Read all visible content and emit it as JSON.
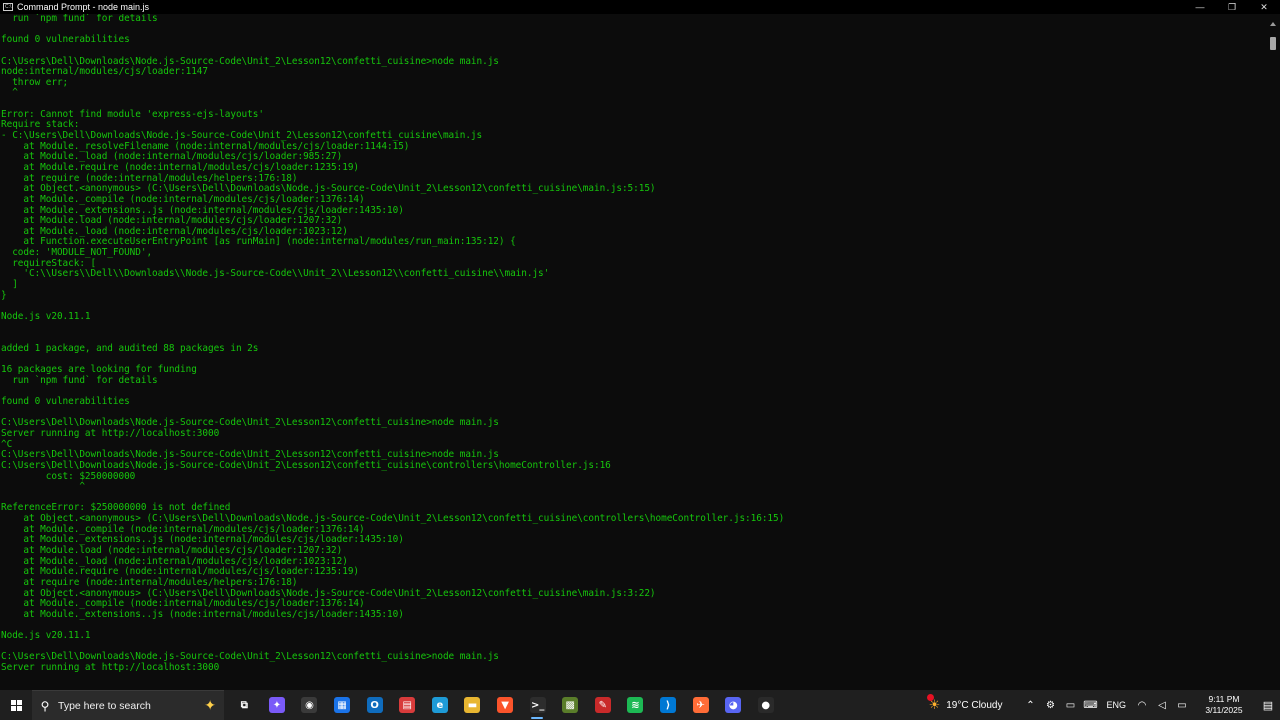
{
  "window": {
    "title": "Command Prompt - node  main.js",
    "icon_label": "C:\\"
  },
  "window_controls": {
    "minimize": "—",
    "maximize": "❐",
    "close": "✕"
  },
  "console_lines": [
    "  run `npm fund` for details",
    "",
    "found 0 vulnerabilities",
    "",
    "C:\\Users\\Dell\\Downloads\\Node.js-Source-Code\\Unit_2\\Lesson12\\confetti_cuisine>node main.js",
    "node:internal/modules/cjs/loader:1147",
    "  throw err;",
    "  ^",
    "",
    "Error: Cannot find module 'express-ejs-layouts'",
    "Require stack:",
    "- C:\\Users\\Dell\\Downloads\\Node.js-Source-Code\\Unit_2\\Lesson12\\confetti_cuisine\\main.js",
    "    at Module._resolveFilename (node:internal/modules/cjs/loader:1144:15)",
    "    at Module._load (node:internal/modules/cjs/loader:985:27)",
    "    at Module.require (node:internal/modules/cjs/loader:1235:19)",
    "    at require (node:internal/modules/helpers:176:18)",
    "    at Object.<anonymous> (C:\\Users\\Dell\\Downloads\\Node.js-Source-Code\\Unit_2\\Lesson12\\confetti_cuisine\\main.js:5:15)",
    "    at Module._compile (node:internal/modules/cjs/loader:1376:14)",
    "    at Module._extensions..js (node:internal/modules/cjs/loader:1435:10)",
    "    at Module.load (node:internal/modules/cjs/loader:1207:32)",
    "    at Module._load (node:internal/modules/cjs/loader:1023:12)",
    "    at Function.executeUserEntryPoint [as runMain] (node:internal/modules/run_main:135:12) {",
    "  code: 'MODULE_NOT_FOUND',",
    "  requireStack: [",
    "    'C:\\\\Users\\\\Dell\\\\Downloads\\\\Node.js-Source-Code\\\\Unit_2\\\\Lesson12\\\\confetti_cuisine\\\\main.js'",
    "  ]",
    "}",
    "",
    "Node.js v20.11.1",
    "",
    "",
    "added 1 package, and audited 88 packages in 2s",
    "",
    "16 packages are looking for funding",
    "  run `npm fund` for details",
    "",
    "found 0 vulnerabilities",
    "",
    "C:\\Users\\Dell\\Downloads\\Node.js-Source-Code\\Unit_2\\Lesson12\\confetti_cuisine>node main.js",
    "Server running at http://localhost:3000",
    "^C",
    "C:\\Users\\Dell\\Downloads\\Node.js-Source-Code\\Unit_2\\Lesson12\\confetti_cuisine>node main.js",
    "C:\\Users\\Dell\\Downloads\\Node.js-Source-Code\\Unit_2\\Lesson12\\confetti_cuisine\\controllers\\homeController.js:16",
    "        cost: $250000000",
    "              ^",
    "",
    "ReferenceError: $250000000 is not defined",
    "    at Object.<anonymous> (C:\\Users\\Dell\\Downloads\\Node.js-Source-Code\\Unit_2\\Lesson12\\confetti_cuisine\\controllers\\homeController.js:16:15)",
    "    at Module._compile (node:internal/modules/cjs/loader:1376:14)",
    "    at Module._extensions..js (node:internal/modules/cjs/loader:1435:10)",
    "    at Module.load (node:internal/modules/cjs/loader:1207:32)",
    "    at Module._load (node:internal/modules/cjs/loader:1023:12)",
    "    at Module.require (node:internal/modules/cjs/loader:1235:19)",
    "    at require (node:internal/modules/helpers:176:18)",
    "    at Object.<anonymous> (C:\\Users\\Dell\\Downloads\\Node.js-Source-Code\\Unit_2\\Lesson12\\confetti_cuisine\\main.js:3:22)",
    "    at Module._compile (node:internal/modules/cjs/loader:1376:14)",
    "    at Module._extensions..js (node:internal/modules/cjs/loader:1435:10)",
    "",
    "Node.js v20.11.1",
    "",
    "C:\\Users\\Dell\\Downloads\\Node.js-Source-Code\\Unit_2\\Lesson12\\confetti_cuisine>node main.js",
    "Server running at http://localhost:3000"
  ],
  "taskbar": {
    "search_placeholder": "Type here to search",
    "apps": [
      {
        "name": "task-view-icon",
        "glyph": "⧉",
        "bg": "transparent",
        "active": false
      },
      {
        "name": "copilot-icon",
        "glyph": "✦",
        "bg": "#7a5af8",
        "active": false
      },
      {
        "name": "recorder-icon",
        "glyph": "◉",
        "bg": "#3a3a3a",
        "active": false
      },
      {
        "name": "calculator-icon",
        "glyph": "▦",
        "bg": "#1a73e8",
        "active": false
      },
      {
        "name": "outlook-icon",
        "glyph": "O",
        "bg": "#0f6cbd",
        "active": false
      },
      {
        "name": "pdf-reader-icon",
        "glyph": "▤",
        "bg": "#d83b3b",
        "active": false
      },
      {
        "name": "edge-icon",
        "glyph": "e",
        "bg": "#1e9bd7",
        "active": false
      },
      {
        "name": "file-explorer-icon",
        "glyph": "▬",
        "bg": "#e8b631",
        "active": false
      },
      {
        "name": "brave-icon",
        "glyph": "▼",
        "bg": "#fb542b",
        "active": false
      },
      {
        "name": "command-prompt-icon",
        "glyph": ">_",
        "bg": "#2d2d2d",
        "active": true
      },
      {
        "name": "minecraft-icon",
        "glyph": "▩",
        "bg": "#5a7d2a",
        "active": false
      },
      {
        "name": "git-icon",
        "glyph": "✎",
        "bg": "#c92a2a",
        "active": false
      },
      {
        "name": "spotify-icon",
        "glyph": "≋",
        "bg": "#1db954",
        "active": false
      },
      {
        "name": "vscode-icon",
        "glyph": "⟩",
        "bg": "#0078d4",
        "active": false
      },
      {
        "name": "postman-icon",
        "glyph": "✈",
        "bg": "#ff6c37",
        "active": false
      },
      {
        "name": "discord-icon",
        "glyph": "◕",
        "bg": "#5865f2",
        "active": false
      },
      {
        "name": "chrome-canary-icon",
        "glyph": "●",
        "bg": "#2a2a2a",
        "active": false
      }
    ],
    "weather": {
      "temp": "19°C",
      "condition": "Cloudy"
    },
    "tray_icons": [
      {
        "name": "show-hidden-icons-icon",
        "glyph": "⌃"
      },
      {
        "name": "network-icon",
        "glyph": "⚙"
      },
      {
        "name": "volume-icon",
        "glyph": "▭"
      },
      {
        "name": "keyboard-icon",
        "glyph": "⌨"
      }
    ],
    "language": "ENG",
    "extra_tray_icons": [
      {
        "name": "wifi-icon",
        "glyph": "◠"
      },
      {
        "name": "speaker-icon",
        "glyph": "◁"
      },
      {
        "name": "battery-icon",
        "glyph": "▭"
      }
    ],
    "time": "9:11 PM",
    "date": "3/11/2025"
  }
}
